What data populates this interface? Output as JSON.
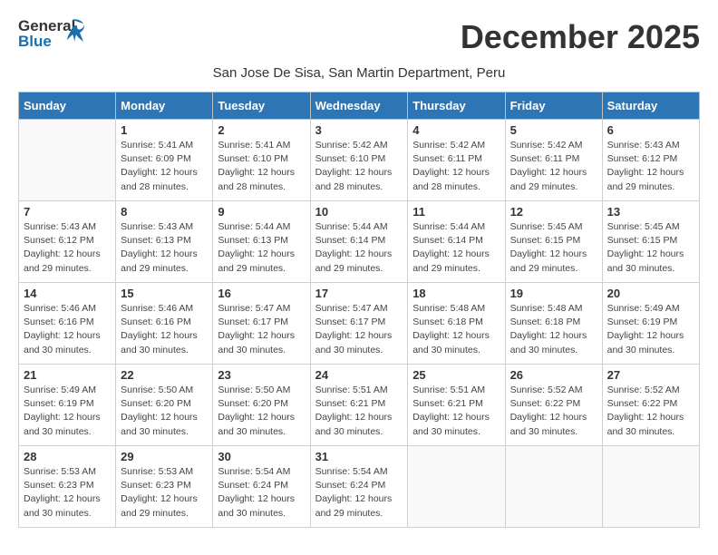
{
  "logo": {
    "general": "General",
    "blue": "Blue"
  },
  "title": "December 2025",
  "subtitle": "San Jose De Sisa, San Martin Department, Peru",
  "header": {
    "days": [
      "Sunday",
      "Monday",
      "Tuesday",
      "Wednesday",
      "Thursday",
      "Friday",
      "Saturday"
    ]
  },
  "weeks": [
    [
      {
        "day": "",
        "info": ""
      },
      {
        "day": "1",
        "info": "Sunrise: 5:41 AM\nSunset: 6:09 PM\nDaylight: 12 hours\nand 28 minutes."
      },
      {
        "day": "2",
        "info": "Sunrise: 5:41 AM\nSunset: 6:10 PM\nDaylight: 12 hours\nand 28 minutes."
      },
      {
        "day": "3",
        "info": "Sunrise: 5:42 AM\nSunset: 6:10 PM\nDaylight: 12 hours\nand 28 minutes."
      },
      {
        "day": "4",
        "info": "Sunrise: 5:42 AM\nSunset: 6:11 PM\nDaylight: 12 hours\nand 28 minutes."
      },
      {
        "day": "5",
        "info": "Sunrise: 5:42 AM\nSunset: 6:11 PM\nDaylight: 12 hours\nand 29 minutes."
      },
      {
        "day": "6",
        "info": "Sunrise: 5:43 AM\nSunset: 6:12 PM\nDaylight: 12 hours\nand 29 minutes."
      }
    ],
    [
      {
        "day": "7",
        "info": "Sunrise: 5:43 AM\nSunset: 6:12 PM\nDaylight: 12 hours\nand 29 minutes."
      },
      {
        "day": "8",
        "info": "Sunrise: 5:43 AM\nSunset: 6:13 PM\nDaylight: 12 hours\nand 29 minutes."
      },
      {
        "day": "9",
        "info": "Sunrise: 5:44 AM\nSunset: 6:13 PM\nDaylight: 12 hours\nand 29 minutes."
      },
      {
        "day": "10",
        "info": "Sunrise: 5:44 AM\nSunset: 6:14 PM\nDaylight: 12 hours\nand 29 minutes."
      },
      {
        "day": "11",
        "info": "Sunrise: 5:44 AM\nSunset: 6:14 PM\nDaylight: 12 hours\nand 29 minutes."
      },
      {
        "day": "12",
        "info": "Sunrise: 5:45 AM\nSunset: 6:15 PM\nDaylight: 12 hours\nand 29 minutes."
      },
      {
        "day": "13",
        "info": "Sunrise: 5:45 AM\nSunset: 6:15 PM\nDaylight: 12 hours\nand 30 minutes."
      }
    ],
    [
      {
        "day": "14",
        "info": "Sunrise: 5:46 AM\nSunset: 6:16 PM\nDaylight: 12 hours\nand 30 minutes."
      },
      {
        "day": "15",
        "info": "Sunrise: 5:46 AM\nSunset: 6:16 PM\nDaylight: 12 hours\nand 30 minutes."
      },
      {
        "day": "16",
        "info": "Sunrise: 5:47 AM\nSunset: 6:17 PM\nDaylight: 12 hours\nand 30 minutes."
      },
      {
        "day": "17",
        "info": "Sunrise: 5:47 AM\nSunset: 6:17 PM\nDaylight: 12 hours\nand 30 minutes."
      },
      {
        "day": "18",
        "info": "Sunrise: 5:48 AM\nSunset: 6:18 PM\nDaylight: 12 hours\nand 30 minutes."
      },
      {
        "day": "19",
        "info": "Sunrise: 5:48 AM\nSunset: 6:18 PM\nDaylight: 12 hours\nand 30 minutes."
      },
      {
        "day": "20",
        "info": "Sunrise: 5:49 AM\nSunset: 6:19 PM\nDaylight: 12 hours\nand 30 minutes."
      }
    ],
    [
      {
        "day": "21",
        "info": "Sunrise: 5:49 AM\nSunset: 6:19 PM\nDaylight: 12 hours\nand 30 minutes."
      },
      {
        "day": "22",
        "info": "Sunrise: 5:50 AM\nSunset: 6:20 PM\nDaylight: 12 hours\nand 30 minutes."
      },
      {
        "day": "23",
        "info": "Sunrise: 5:50 AM\nSunset: 6:20 PM\nDaylight: 12 hours\nand 30 minutes."
      },
      {
        "day": "24",
        "info": "Sunrise: 5:51 AM\nSunset: 6:21 PM\nDaylight: 12 hours\nand 30 minutes."
      },
      {
        "day": "25",
        "info": "Sunrise: 5:51 AM\nSunset: 6:21 PM\nDaylight: 12 hours\nand 30 minutes."
      },
      {
        "day": "26",
        "info": "Sunrise: 5:52 AM\nSunset: 6:22 PM\nDaylight: 12 hours\nand 30 minutes."
      },
      {
        "day": "27",
        "info": "Sunrise: 5:52 AM\nSunset: 6:22 PM\nDaylight: 12 hours\nand 30 minutes."
      }
    ],
    [
      {
        "day": "28",
        "info": "Sunrise: 5:53 AM\nSunset: 6:23 PM\nDaylight: 12 hours\nand 30 minutes."
      },
      {
        "day": "29",
        "info": "Sunrise: 5:53 AM\nSunset: 6:23 PM\nDaylight: 12 hours\nand 29 minutes."
      },
      {
        "day": "30",
        "info": "Sunrise: 5:54 AM\nSunset: 6:24 PM\nDaylight: 12 hours\nand 30 minutes."
      },
      {
        "day": "31",
        "info": "Sunrise: 5:54 AM\nSunset: 6:24 PM\nDaylight: 12 hours\nand 29 minutes."
      },
      {
        "day": "",
        "info": ""
      },
      {
        "day": "",
        "info": ""
      },
      {
        "day": "",
        "info": ""
      }
    ]
  ]
}
